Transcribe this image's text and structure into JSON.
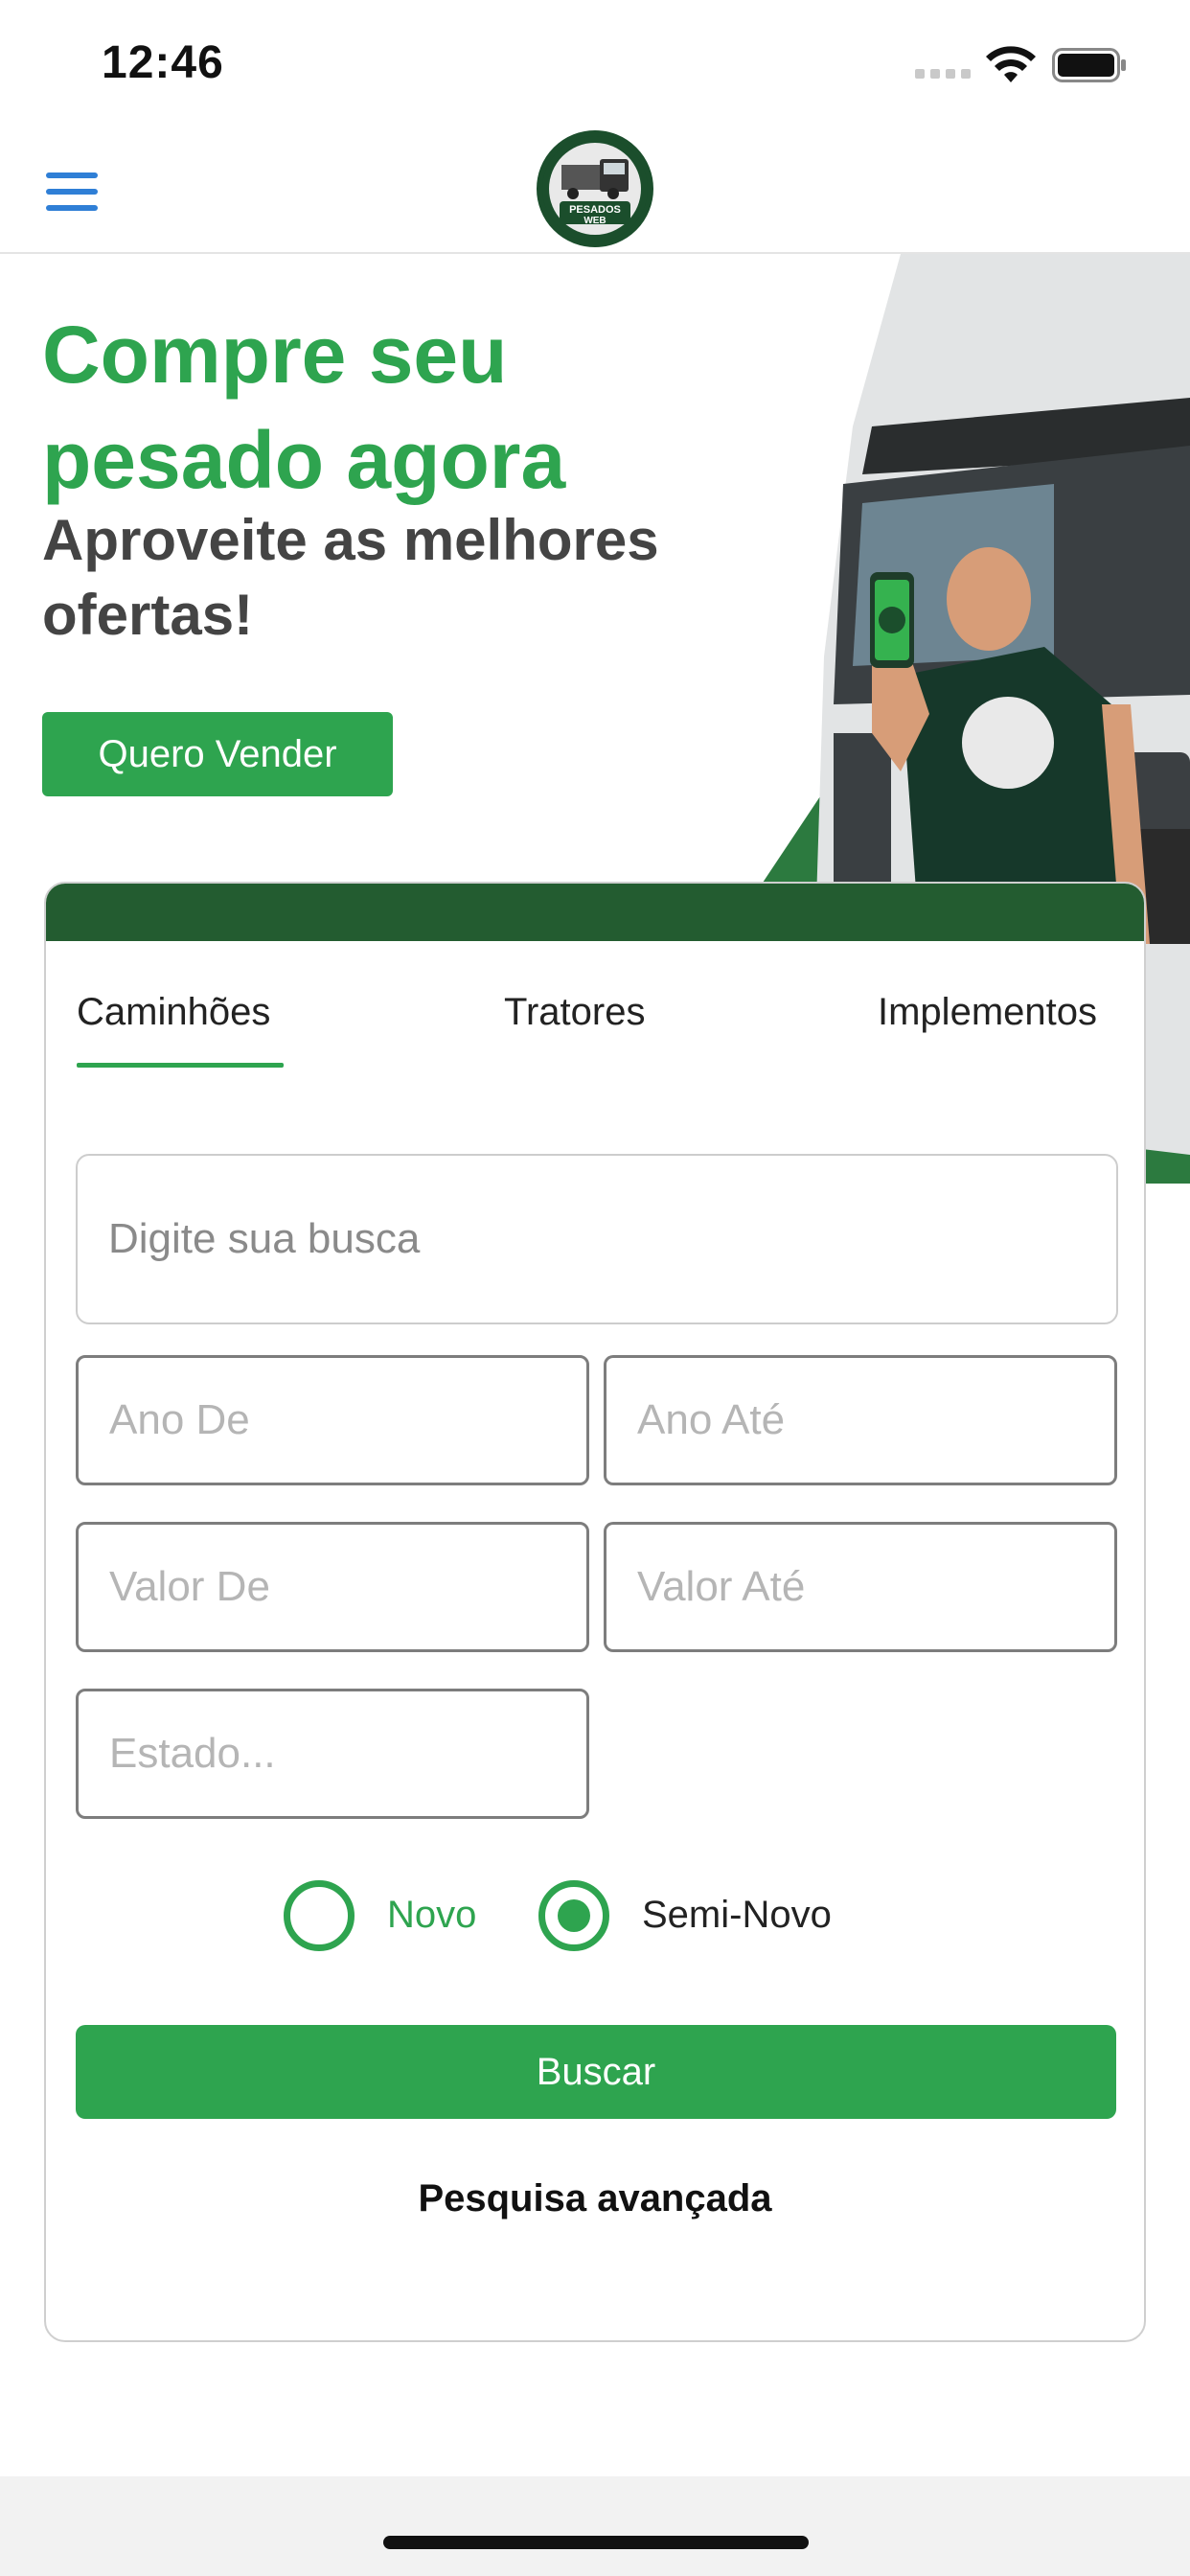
{
  "status_bar": {
    "time": "12:46"
  },
  "header": {
    "logo_text": [
      "PESADOS",
      "WEB"
    ]
  },
  "hero": {
    "title": "Compre seu pesado agora",
    "subtitle": "Aproveite as melhores ofertas!",
    "sell_button": "Quero Vender"
  },
  "search": {
    "tabs": [
      {
        "label": "Caminhões",
        "active": true
      },
      {
        "label": "Tratores",
        "active": false
      },
      {
        "label": "Implementos",
        "active": false
      }
    ],
    "query_placeholder": "Digite sua busca",
    "year_from_placeholder": "Ano De",
    "year_to_placeholder": "Ano Até",
    "value_from_placeholder": "Valor De",
    "value_to_placeholder": "Valor Até",
    "state_placeholder": "Estado...",
    "condition_options": [
      {
        "label": "Novo",
        "selected": false
      },
      {
        "label": "Semi-Novo",
        "selected": true
      }
    ],
    "search_button": "Buscar",
    "advanced_link": "Pesquisa avançada"
  },
  "colors": {
    "primary_green": "#2ea44f",
    "dark_green": "#235c30",
    "heading_gray": "#444444",
    "menu_blue": "#2f7fd6"
  }
}
